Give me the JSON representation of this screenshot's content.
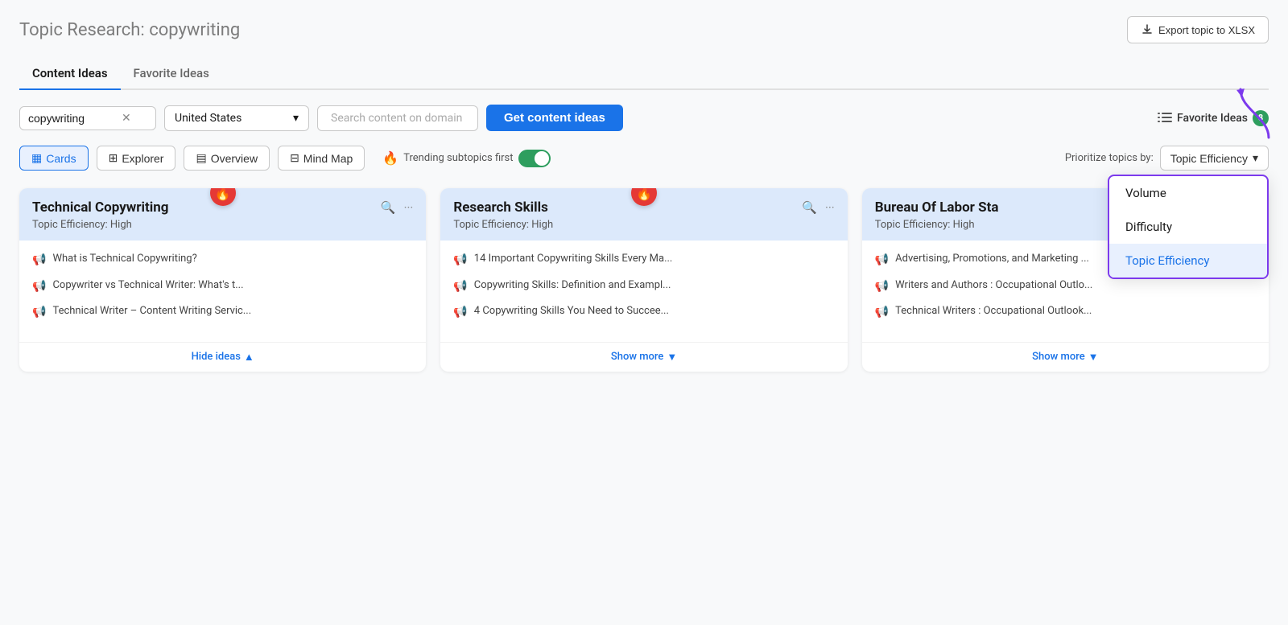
{
  "header": {
    "title": "Topic Research:",
    "keyword": "copywriting",
    "export_btn": "Export topic to XLSX"
  },
  "tabs": [
    {
      "id": "content-ideas",
      "label": "Content Ideas",
      "active": true
    },
    {
      "id": "favorite-ideas",
      "label": "Favorite Ideas",
      "active": false
    }
  ],
  "toolbar": {
    "search_value": "copywriting",
    "country_label": "United States",
    "domain_placeholder": "Search content on domain",
    "get_ideas_label": "Get content ideas",
    "favorite_ideas_label": "Favorite Ideas",
    "favorite_count": "8"
  },
  "view_toolbar": {
    "views": [
      {
        "id": "cards",
        "label": "Cards",
        "icon": "▦",
        "active": true
      },
      {
        "id": "explorer",
        "label": "Explorer",
        "icon": "⊞",
        "active": false
      },
      {
        "id": "overview",
        "label": "Overview",
        "icon": "▤",
        "active": false
      },
      {
        "id": "mind-map",
        "label": "Mind Map",
        "icon": "⊟",
        "active": false
      }
    ],
    "trending_label": "Trending subtopics first",
    "trending_enabled": true,
    "prioritize_label": "Prioritize topics by:",
    "priority_selected": "Topic Efficiency",
    "priority_options": [
      {
        "id": "volume",
        "label": "Volume",
        "selected": false
      },
      {
        "id": "difficulty",
        "label": "Difficulty",
        "selected": false
      },
      {
        "id": "topic-efficiency",
        "label": "Topic Efficiency",
        "selected": true
      }
    ]
  },
  "cards": [
    {
      "id": "card-1",
      "title": "Technical Copywriting",
      "efficiency": "Topic Efficiency: High",
      "trending": true,
      "links": [
        {
          "type": "green",
          "text": "What is Technical Copywriting?"
        },
        {
          "type": "blue",
          "text": "Copywriter vs Technical Writer: What's t..."
        },
        {
          "type": "blue",
          "text": "Technical Writer – Content Writing Servic..."
        }
      ],
      "footer_label": "Hide ideas",
      "footer_icon": "▲",
      "footer_type": "hide"
    },
    {
      "id": "card-2",
      "title": "Research Skills",
      "efficiency": "Topic Efficiency: High",
      "trending": true,
      "links": [
        {
          "type": "green",
          "text": "14 Important Copywriting Skills Every Ma..."
        },
        {
          "type": "blue",
          "text": "Copywriting Skills: Definition and Exampl..."
        },
        {
          "type": "blue",
          "text": "4 Copywriting Skills You Need to Succee..."
        }
      ],
      "footer_label": "Show more",
      "footer_icon": "▼",
      "footer_type": "show"
    },
    {
      "id": "card-3",
      "title": "Bureau Of Labor Sta",
      "efficiency": "Topic Efficiency: High",
      "trending": false,
      "links": [
        {
          "type": "green",
          "text": "Advertising, Promotions, and Marketing ..."
        },
        {
          "type": "blue",
          "text": "Writers and Authors : Occupational Outlo..."
        },
        {
          "type": "blue",
          "text": "Technical Writers : Occupational Outlook..."
        }
      ],
      "footer_label": "Show more",
      "footer_icon": "▼",
      "footer_type": "show"
    }
  ],
  "dropdown": {
    "visible": true,
    "options": [
      {
        "label": "Volume",
        "selected": false
      },
      {
        "label": "Difficulty",
        "selected": false
      },
      {
        "label": "Topic Efficiency",
        "selected": true
      }
    ]
  }
}
